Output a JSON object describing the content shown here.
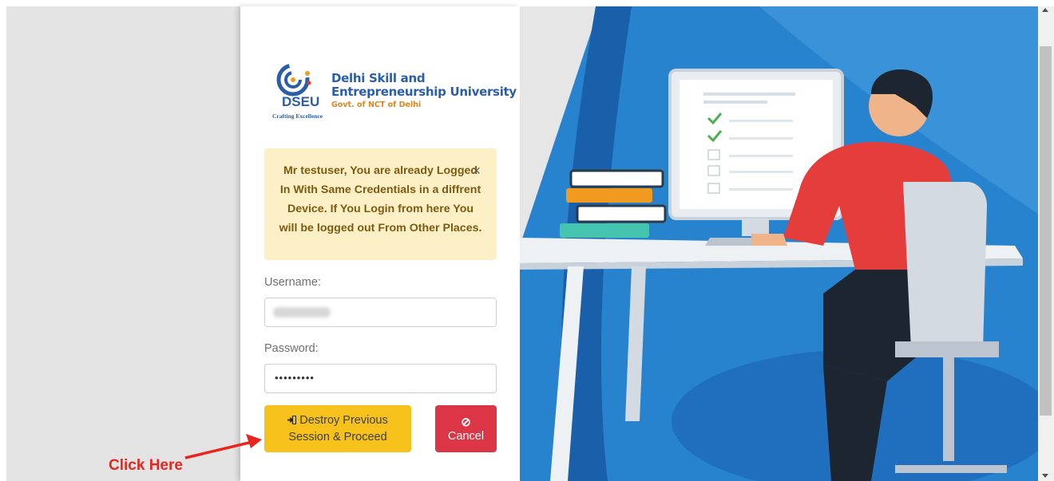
{
  "logo": {
    "university_line1": "Delhi Skill and",
    "university_line2": "Entrepreneurship University",
    "govt": "Govt. of NCT of Delhi",
    "abbr": "DSEU",
    "tagline": "Crafting Excellence"
  },
  "alert": {
    "message": "Mr testuser, You are already Logged In With Same Credentials in a diffrent Device. If You Login from here You will be logged out From Other Places.",
    "close_symbol": "×"
  },
  "form": {
    "username_label": "Username:",
    "password_label": "Password:",
    "password_value": "•••••••••"
  },
  "buttons": {
    "destroy_line1": "Destroy Previous",
    "destroy_line2": "Session & Proceed",
    "cancel_label": "Cancel",
    "cancel_icon": "⊘"
  },
  "annotation": {
    "text": "Click Here"
  },
  "colors": {
    "accent_yellow": "#f6c11a",
    "danger_red": "#dc3545",
    "brand_blue": "#2a5ea8",
    "alert_bg": "#fdf0c7",
    "illustration_blue": "#1e7fd0"
  }
}
